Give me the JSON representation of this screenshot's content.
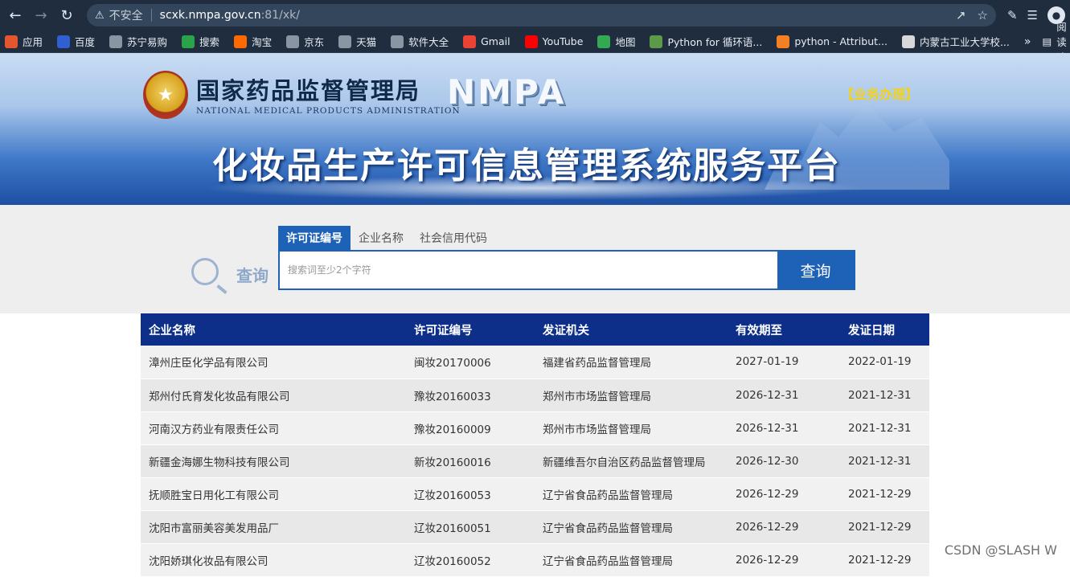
{
  "browser": {
    "insecure_label": "不安全",
    "url_host": "scxk.nmpa.gov.cn",
    "url_rest": ":81/xk/"
  },
  "bookmarks": {
    "items": [
      {
        "label": "应用",
        "color": "#e4572e"
      },
      {
        "label": "百度",
        "color": "#2f5fd0"
      },
      {
        "label": "苏宁易购",
        "color": "#8a95a3"
      },
      {
        "label": "搜索",
        "color": "#2aa34a"
      },
      {
        "label": "淘宝",
        "color": "#ff6a00"
      },
      {
        "label": "京东",
        "color": "#8a95a3"
      },
      {
        "label": "天猫",
        "color": "#8a95a3"
      },
      {
        "label": "软件大全",
        "color": "#8a95a3"
      },
      {
        "label": "Gmail",
        "color": "#ea4335"
      },
      {
        "label": "YouTube",
        "color": "#ff0000"
      },
      {
        "label": "地图",
        "color": "#34a853"
      },
      {
        "label": "Python for 循环语...",
        "color": "#5b9a4b"
      },
      {
        "label": "python - Attribut...",
        "color": "#f48024"
      },
      {
        "label": "内蒙古工业大学校...",
        "color": "#d8d8d8"
      }
    ],
    "more_label": "»",
    "reading_label": "阅读清"
  },
  "banner": {
    "org_cn": "国家药品监督管理局",
    "org_en": "NATIONAL MEDICAL PRODUCTS ADMINISTRATION",
    "nmpa": "NMPA",
    "business_link": "【业务办理】",
    "system_title": "化妆品生产许可信息管理系统服务平台"
  },
  "search": {
    "query_label": "查询",
    "tabs": [
      "许可证编号",
      "企业名称",
      "社会信用代码"
    ],
    "placeholder": "搜索词至少2个字符",
    "button_label": "查询"
  },
  "table": {
    "headers": [
      "企业名称",
      "许可证编号",
      "发证机关",
      "有效期至",
      "发证日期"
    ],
    "rows": [
      [
        "漳州庄臣化学品有限公司",
        "闽妆20170006",
        "福建省药品监督管理局",
        "2027-01-19",
        "2022-01-19"
      ],
      [
        "郑州付氏育发化妆品有限公司",
        "豫妆20160033",
        "郑州市市场监督管理局",
        "2026-12-31",
        "2021-12-31"
      ],
      [
        "河南汉方药业有限责任公司",
        "豫妆20160009",
        "郑州市市场监督管理局",
        "2026-12-31",
        "2021-12-31"
      ],
      [
        "新疆金海娜生物科技有限公司",
        "新妆20160016",
        "新疆维吾尔自治区药品监督管理局",
        "2026-12-30",
        "2021-12-31"
      ],
      [
        "抚顺胜宝日用化工有限公司",
        "辽妆20160053",
        "辽宁省食品药品监督管理局",
        "2026-12-29",
        "2021-12-29"
      ],
      [
        "沈阳市富丽美容美发用品厂",
        "辽妆20160051",
        "辽宁省食品药品监督管理局",
        "2026-12-29",
        "2021-12-29"
      ],
      [
        "沈阳娇琪化妆品有限公司",
        "辽妆20160052",
        "辽宁省食品药品监督管理局",
        "2026-12-29",
        "2021-12-29"
      ]
    ]
  },
  "watermark": "CSDN @SLASH W"
}
